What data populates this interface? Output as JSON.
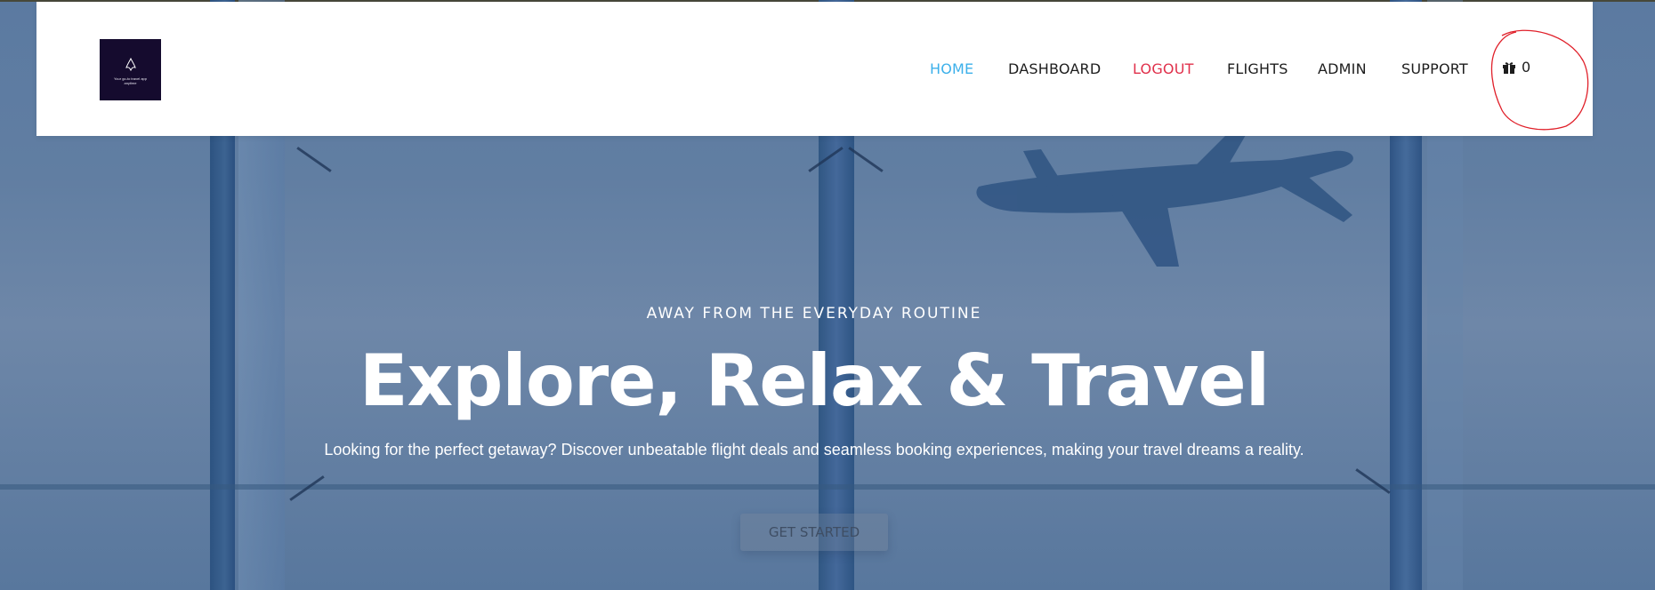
{
  "brand": {
    "logo_icon": "butterfly-icon",
    "logo_tagline": "Your go-to travel app anytime",
    "colors": {
      "logo_bg": "#150b2e"
    }
  },
  "nav": {
    "items": [
      {
        "label": "HOME",
        "state": "active"
      },
      {
        "label": "DASHBOARD",
        "state": "normal"
      },
      {
        "label": "LOGOUT",
        "state": "highlight"
      },
      {
        "label": "FLIGHTS",
        "state": "normal"
      },
      {
        "label": "ADMIN",
        "state": "normal"
      },
      {
        "label": "SUPPORT",
        "state": "normal"
      }
    ],
    "cart": {
      "icon": "gift-icon",
      "count": "0"
    },
    "colors": {
      "active": "#3cb0ea",
      "logout": "#e0304b",
      "text": "#1d1d1d"
    }
  },
  "hero": {
    "eyebrow": "AWAY FROM THE EVERYDAY ROUTINE",
    "title": "Explore, Relax & Travel",
    "subtitle": "Looking for the perfect getaway? Discover unbeatable flight deals and seamless booking experiences, making your travel dreams a reality.",
    "cta_label": "GET STARTED"
  }
}
